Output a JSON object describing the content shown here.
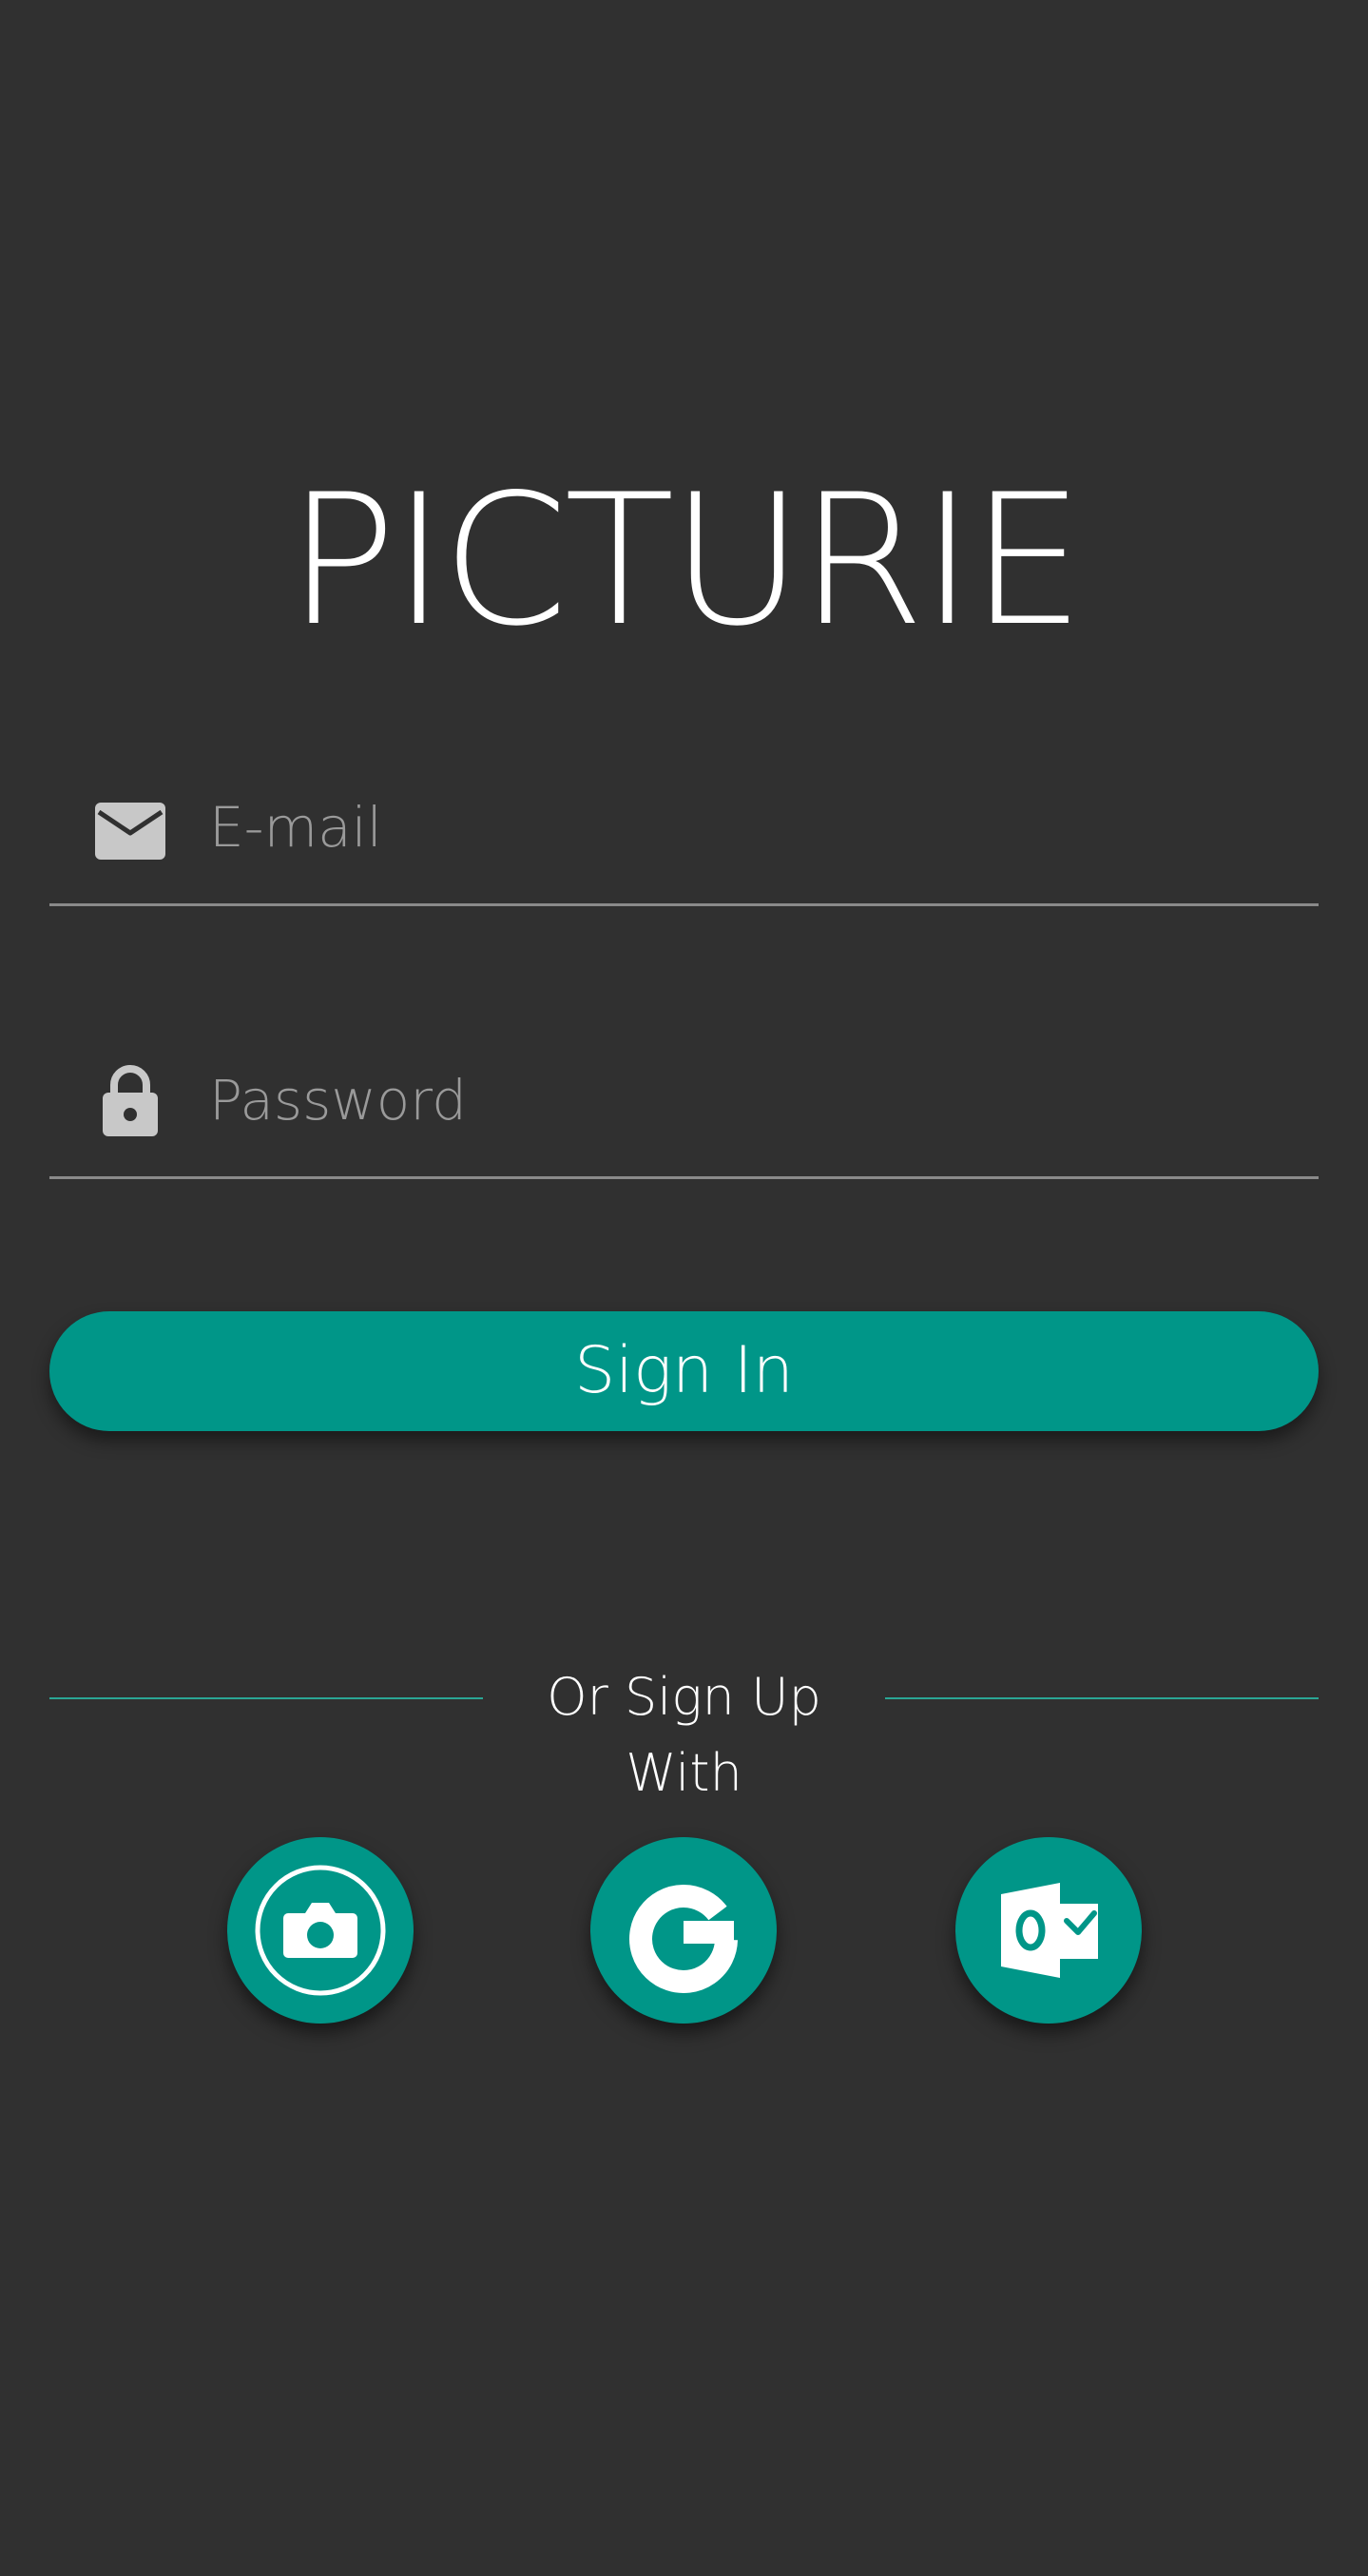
{
  "app": {
    "title": "PICTURIE"
  },
  "login": {
    "email_placeholder": "E-mail",
    "email_value": "",
    "password_placeholder": "Password",
    "password_value": "",
    "sign_in_label": "Sign In"
  },
  "social": {
    "divider_text": "Or Sign Up With",
    "buttons": [
      {
        "icon": "camera-icon"
      },
      {
        "icon": "google-icon"
      },
      {
        "icon": "outlook-icon"
      }
    ]
  },
  "colors": {
    "background": "#303030",
    "accent": "#009688",
    "divider": "#2aa695",
    "field_underline": "#8a8a8a",
    "placeholder": "#9a9a9a",
    "icon_gray": "#c8c8c8"
  }
}
